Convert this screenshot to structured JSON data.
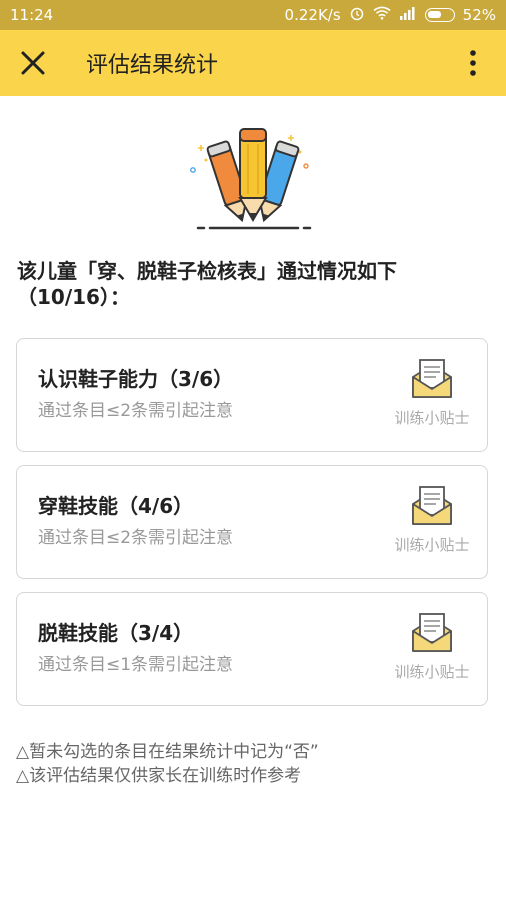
{
  "status_bar": {
    "time": "11:24",
    "speed": "0.22K/s",
    "battery": "52%"
  },
  "toolbar": {
    "title": "评估结果统计",
    "close_icon": "close-icon",
    "more_icon": "more-vertical-icon"
  },
  "summary": {
    "line1": "该儿童「穿、脱鞋子检核表」通过情况如下",
    "line2": "（10/16）："
  },
  "cards": [
    {
      "title": "认识鞋子能力（3/6）",
      "note": "通过条目≤2条需引起注意",
      "tips": "训练小贴士"
    },
    {
      "title": "穿鞋技能（4/6）",
      "note": "通过条目≤2条需引起注意",
      "tips": "训练小贴士"
    },
    {
      "title": "脱鞋技能（3/4）",
      "note": "通过条目≤1条需引起注意",
      "tips": "训练小贴士"
    }
  ],
  "notes": {
    "line1": "△暂未勾选的条目在结果统计中记为“否”",
    "line2": "△该评估结果仅供家长在训练时作参考"
  },
  "colors": {
    "toolbar": "#fad54b",
    "status_bar": "#c9a93b",
    "pencil_orange": "#f08a3c",
    "pencil_yellow": "#f7c531",
    "pencil_blue": "#4aa8ea",
    "envelope": "#f5d87a"
  }
}
